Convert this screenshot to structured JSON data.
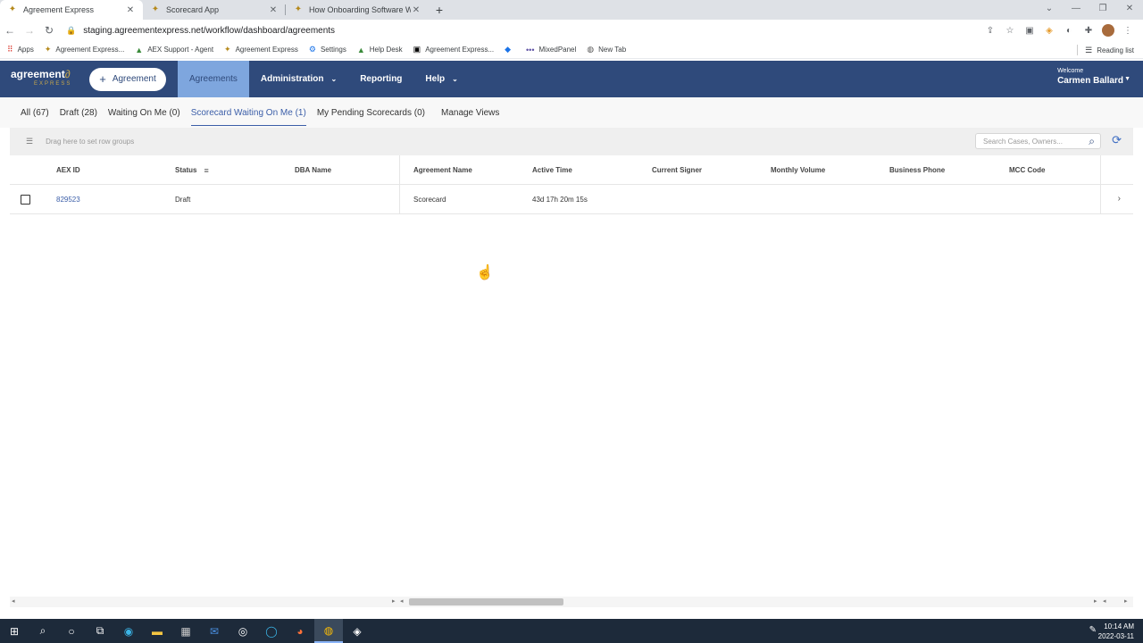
{
  "browser": {
    "tabs": [
      {
        "title": "Agreement Express",
        "active": true
      },
      {
        "title": "Scorecard App",
        "active": false
      },
      {
        "title": "How Onboarding Software Work",
        "active": false
      }
    ],
    "url": "staging.agreementexpress.net/workflow/dashboard/agreements",
    "bookmarks": [
      {
        "label": "Apps",
        "icon": "apps-grid-icon"
      },
      {
        "label": "Agreement Express...",
        "icon": "aex-icon"
      },
      {
        "label": "AEX Support - Agent",
        "icon": "support-icon"
      },
      {
        "label": "Agreement Express",
        "icon": "aex-icon"
      },
      {
        "label": "Settings",
        "icon": "gear-icon"
      },
      {
        "label": "Help Desk",
        "icon": "support-icon"
      },
      {
        "label": "Agreement Express...",
        "icon": "plus-square-icon"
      },
      {
        "label": "",
        "icon": "diamond-icon"
      },
      {
        "label": "MixedPanel",
        "icon": "dots-icon"
      },
      {
        "label": "New Tab",
        "icon": "globe-icon"
      }
    ],
    "reading_list": "Reading list"
  },
  "app": {
    "logo_main": "agreement",
    "logo_sub": "EXPRESS",
    "new_button": "Agreement",
    "nav": {
      "agreements": "Agreements",
      "administration": "Administration",
      "reporting": "Reporting",
      "help": "Help"
    },
    "welcome_label": "Welcome",
    "user_name": "Carmen Ballard"
  },
  "views": {
    "all": "All (67)",
    "draft": "Draft (28)",
    "waiting": "Waiting On Me (0)",
    "scorecard_waiting": "Scorecard Waiting On Me (1)",
    "pending_scorecards": "My Pending Scorecards (0)",
    "manage": "Manage Views"
  },
  "grid": {
    "row_group_hint": "Drag here to set row groups",
    "search_placeholder": "Search Cases, Owners...",
    "columns": {
      "aex_id": "AEX ID",
      "status": "Status",
      "dba_name": "DBA Name",
      "agreement_name": "Agreement Name",
      "active_time": "Active Time",
      "current_signer": "Current Signer",
      "monthly_volume": "Monthly Volume",
      "business_phone": "Business Phone",
      "mcc_code": "MCC Code"
    },
    "rows": [
      {
        "aex_id": "829523",
        "status": "Draft",
        "dba_name": "",
        "agreement_name": "Scorecard",
        "active_time": "43d 17h 20m 15s",
        "current_signer": "",
        "monthly_volume": "",
        "business_phone": "",
        "mcc_code": ""
      }
    ]
  },
  "taskbar": {
    "time": "10:14 AM",
    "date": "2022-03-11"
  },
  "colors": {
    "header": "#2f4a7b",
    "active_nav": "#7ea6de",
    "accent": "#3b5ea8",
    "logo_gold": "#c9a84a"
  }
}
